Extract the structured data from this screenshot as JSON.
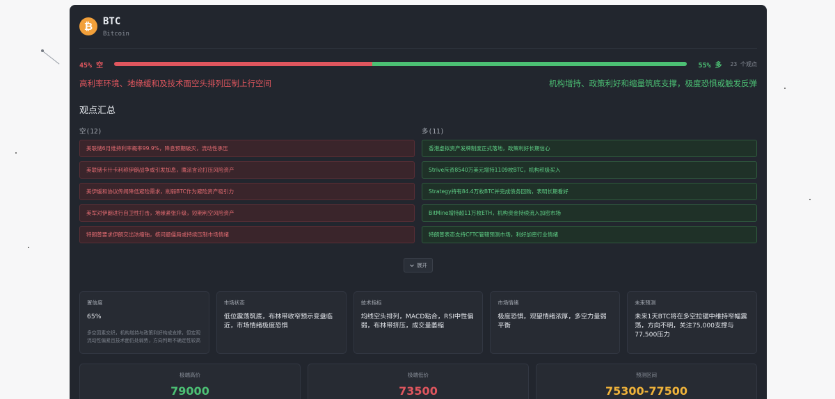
{
  "asset": {
    "icon": "bitcoin-icon",
    "symbol": "BTC",
    "name": "Bitcoin",
    "icon_color": "#f2a03a",
    "icon_glyph": "₿"
  },
  "ratio": {
    "short_label": "45%  空",
    "short_pct": 45,
    "long_label": "55%  多",
    "long_pct": 55,
    "views_text": "23 个观点"
  },
  "theses": {
    "short": "高利率环境、地缘缓和及技术面空头排列压制上行空间",
    "long": "机构增持、政策利好和缩量筑底支撑，极度恐惧或触发反弹"
  },
  "summary": {
    "title": "观点汇总",
    "short_header": "空(12)",
    "long_header": "多(11)",
    "short_items": [
      "美联储6月维持利率概率99.9%，降息预期破灭，流动性承压",
      "美联储卡什卡利称伊朗战争或引发加息，鹰派言论打压风险资产",
      "美伊缓和协议传闻降低避险需求，削弱BTC作为避险资产吸引力",
      "美军对伊朗进行自卫性打击，地缘紧张升级，短期利空风险资产",
      "特朗普要求伊朗交出浓缩铀，核问题僵局或持续压制市场情绪"
    ],
    "long_items": [
      "香港虚拟资产发牌制度正式落地，政策利好长期信心",
      "Strive斥资8540万美元增持1109枚BTC，机构积极买入",
      "Strategy持有84.4万枚BTC并完成债务回购，表明长期看好",
      "BitMine增持超11万枚ETH，机构资金持续流入加密市场",
      "特朗普表态支持CFTC管辖预测市场，利好加密行业情绪"
    ],
    "expand_label": "展开",
    "expand_icon": "chevron-down-icon"
  },
  "panels": {
    "confidence": {
      "label": "置信度",
      "value": "65%",
      "note": "多空因素交织，机构增持与政策利好构成支撑，但宏观流动性偏紧且技术面仍处弱势，方向判断不确定性较高"
    },
    "market_state": {
      "label": "市场状态",
      "value": "低位震荡筑底，布林带收窄预示变盘临近，市场情绪极度恐惧"
    },
    "technical": {
      "label": "技术指标",
      "value": "均线空头排列，MACD粘合，RSI中性偏弱，布林带挤压，成交量萎缩"
    },
    "sentiment": {
      "label": "市场情绪",
      "value": "极度恐惧，观望情绪浓厚，多空力量弱平衡"
    },
    "forecast": {
      "label": "未来预测",
      "value": "未来1天BTC将在多空拉锯中维持窄幅震荡，方向不明，关注75,000支撑与77,500压力"
    }
  },
  "prices": {
    "high": {
      "label": "极端高价",
      "value": "79000",
      "color": "#4cc074"
    },
    "low": {
      "label": "极端低价",
      "value": "73500",
      "color": "#e0565e"
    },
    "range": {
      "label": "预测区间",
      "value": "75300-77500",
      "color": "#f0b33a"
    }
  }
}
